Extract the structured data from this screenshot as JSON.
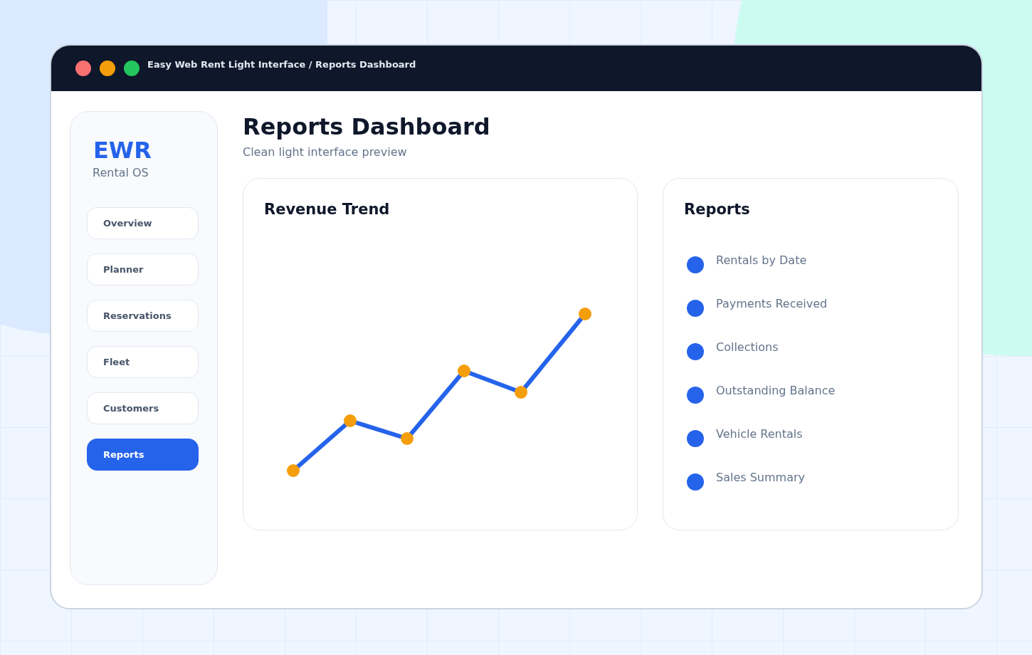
{
  "window": {
    "title": "Easy Web Rent Light Interface / Reports Dashboard"
  },
  "sidebar": {
    "logo": "EWR",
    "subtitle": "Rental OS",
    "items": [
      {
        "label": "Overview",
        "selected": false
      },
      {
        "label": "Planner",
        "selected": false
      },
      {
        "label": "Reservations",
        "selected": false
      },
      {
        "label": "Fleet",
        "selected": false
      },
      {
        "label": "Customers",
        "selected": false
      },
      {
        "label": "Reports",
        "selected": true
      }
    ]
  },
  "header": {
    "title": "Reports Dashboard",
    "subtitle": "Clean light interface preview"
  },
  "revenue_card": {
    "title": "Revenue Trend"
  },
  "reports_card": {
    "title": "Reports",
    "items": [
      {
        "label": "Rentals by Date"
      },
      {
        "label": "Payments Received"
      },
      {
        "label": "Collections"
      },
      {
        "label": "Outstanding Balance"
      },
      {
        "label": "Vehicle Rentals"
      },
      {
        "label": "Sales Summary"
      }
    ]
  }
}
